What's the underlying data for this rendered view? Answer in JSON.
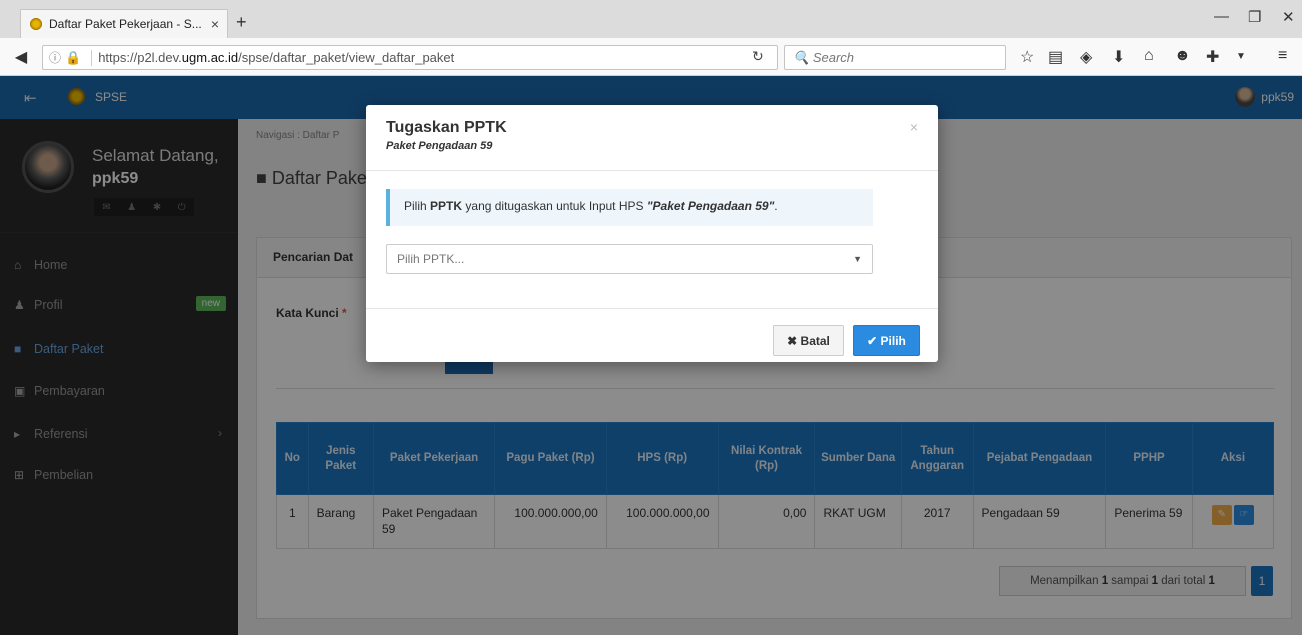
{
  "browser": {
    "tab_title": "Daftar Paket Pekerjaan - S...",
    "tab_close": "×",
    "new_tab": "+",
    "url_prefix": "https://p2l.dev.",
    "url_domain": "ugm.ac.id",
    "url_path": "/spse/daftar_paket/view_daftar_paket",
    "search_placeholder": "Search"
  },
  "header": {
    "brand": "SPSE",
    "user": "ppk59"
  },
  "sidebar": {
    "welcome": "Selamat Datang,",
    "username": "ppk59",
    "items": [
      {
        "label": "Home",
        "icon": "home-icon",
        "glyph": "⌂"
      },
      {
        "label": "Profil",
        "icon": "user-icon",
        "glyph": "♟",
        "badge": "new"
      },
      {
        "label": "Daftar Paket",
        "icon": "book-icon",
        "glyph": "■"
      },
      {
        "label": "Pembayaran",
        "icon": "money-icon",
        "glyph": "▣"
      },
      {
        "label": "Referensi",
        "icon": "caret-right-icon",
        "glyph": "▸"
      },
      {
        "label": "Pembelian",
        "icon": "cart-icon",
        "glyph": "⊞"
      }
    ]
  },
  "content": {
    "breadcrumb": "Navigasi : Daftar P",
    "page_title": "Daftar Pake",
    "panel_title": "Pencarian Dat",
    "kata_kunci": "Kata Kunci",
    "required": "*"
  },
  "table": {
    "headers": [
      "No",
      "Jenis Paket",
      "Paket Pekerjaan",
      "Pagu Paket (Rp)",
      "HPS (Rp)",
      "Nilai Kontrak (Rp)",
      "Sumber Dana",
      "Tahun Anggaran",
      "Pejabat Pengadaan",
      "PPHP",
      "Aksi"
    ],
    "rows": [
      [
        "1",
        "Barang",
        "Paket Pengadaan 59",
        "100.000.000,00",
        "100.000.000,00",
        "0,00",
        "RKAT UGM",
        "2017",
        "Pengadaan 59",
        "Penerima 59"
      ]
    ]
  },
  "pager": {
    "prefix": "Menampilkan",
    "from": "1",
    "mid": "sampai",
    "to": "1",
    "mid2": "dari total",
    "total": "1",
    "page": "1"
  },
  "modal": {
    "title": "Tugaskan PPTK",
    "subtitle": "Paket Pengadaan 59",
    "close": "×",
    "alert_pre": "Pilih",
    "alert_bold": "PPTK",
    "alert_mid": "yang ditugaskan untuk Input HPS",
    "alert_em": "\"Paket Pengadaan 59\"",
    "alert_end": ".",
    "select_placeholder": "Pilih PPTK...",
    "cancel_label": "Batal",
    "ok_label": "Pilih"
  },
  "colors": {
    "header_blue": "#1c6bb0",
    "sidebar_bg": "#2a2a2a",
    "table_head": "#1c76c0",
    "primary_button": "#2a8be0"
  }
}
